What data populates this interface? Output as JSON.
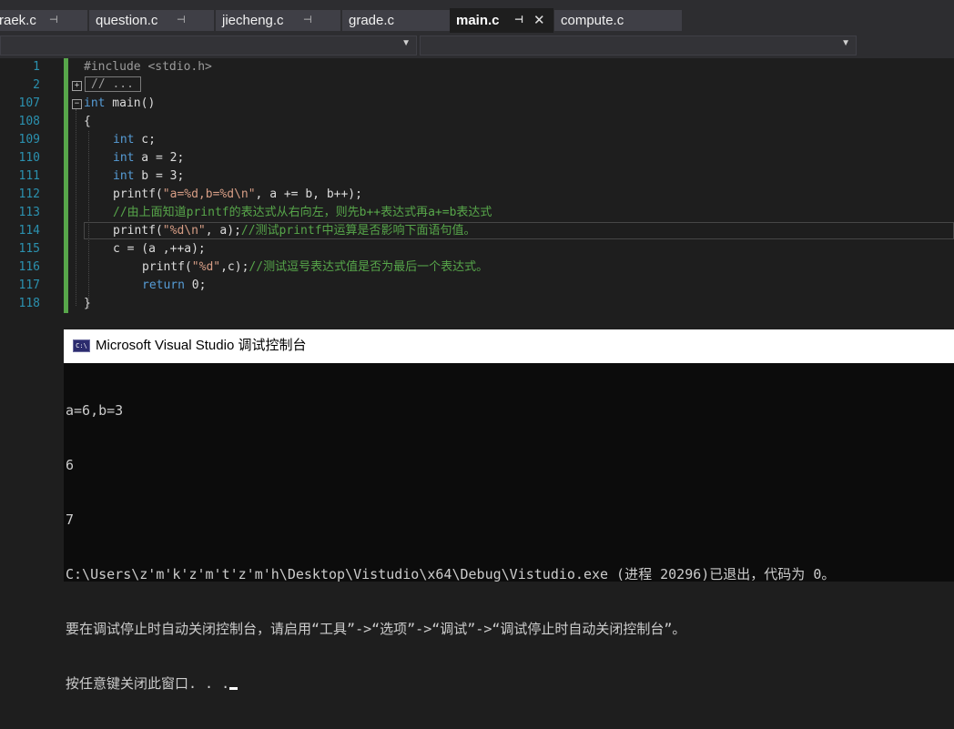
{
  "tabs": [
    {
      "label": "raek.c",
      "pinned": true,
      "active": false
    },
    {
      "label": "question.c",
      "pinned": true,
      "active": false
    },
    {
      "label": "jiecheng.c",
      "pinned": true,
      "active": false
    },
    {
      "label": "grade.c",
      "pinned": false,
      "active": false
    },
    {
      "label": "main.c",
      "pinned": true,
      "active": true
    },
    {
      "label": "compute.c",
      "pinned": false,
      "active": false
    }
  ],
  "icons": {
    "pin": "⊣",
    "pin_active": "⊣",
    "close": "✕",
    "dropdown": "▼",
    "expand": "+",
    "collapse": "−"
  },
  "editor": {
    "line_numbers": [
      "1",
      "2",
      "107",
      "108",
      "109",
      "110",
      "111",
      "112",
      "113",
      "114",
      "115",
      "116",
      "117",
      "118"
    ],
    "collapsed_region": "// ...",
    "lines": {
      "l1": "#include <stdio.h>",
      "l107_kw": "int",
      "l107_rest": " main()",
      "l108": "{",
      "l109_kw": "int",
      "l109_rest": " c;",
      "l110_kw": "int",
      "l110_rest": " a = 2;",
      "l111_kw": "int",
      "l111_rest": " b = 3;",
      "l112_a": "printf(",
      "l112_str": "\"a=%d,b=%d\\n\"",
      "l112_b": ", a += b, b++);",
      "l113_comment": "//由上面知道printf的表达式从右向左，则先b++表达式再a+=b表达式",
      "l114_a": "printf(",
      "l114_str": "\"%d\\n\"",
      "l114_b": ", a);",
      "l114_comment": "//测试printf中运算是否影响下面语句值。",
      "l115": "c = (a ,++a);",
      "l116_a": "printf(",
      "l116_str": "\"%d\"",
      "l116_b": ",c);",
      "l116_comment": "//测试逗号表达式值是否为最后一个表达式。",
      "l117_kw": "return",
      "l117_rest": " 0;",
      "l118": "}"
    }
  },
  "console": {
    "title": "Microsoft Visual Studio 调试控制台",
    "icon_label": "C:\\",
    "output": [
      "a=6,b=3",
      "6",
      "7",
      "C:\\Users\\z'm'k'z'm't'z'm'h\\Desktop\\Vistudio\\x64\\Debug\\Vistudio.exe (进程 20296)已退出，代码为 0。",
      "要在调试停止时自动关闭控制台，请启用“工具”->“选项”->“调试”->“调试停止时自动关闭控制台”。",
      "按任意键关闭此窗口. . ."
    ]
  },
  "colors": {
    "keyword": "#569cd6",
    "string": "#d69d85",
    "comment": "#57a64a",
    "line_number": "#2b91af",
    "change_bar": "#57a64a"
  }
}
